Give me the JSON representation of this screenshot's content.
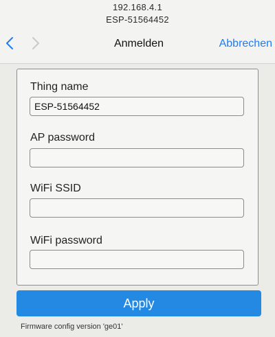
{
  "header": {
    "ip": "192.168.4.1",
    "host": "ESP-51564452",
    "title": "Anmelden",
    "cancel": "Abbrechen",
    "back_icon": "chevron-left-icon",
    "forward_icon": "chevron-right-icon"
  },
  "form": {
    "fields": [
      {
        "label": "Thing name",
        "value": "ESP-51564452",
        "placeholder": ""
      },
      {
        "label": "AP password",
        "value": "",
        "placeholder": ""
      },
      {
        "label": "WiFi SSID",
        "value": "",
        "placeholder": ""
      },
      {
        "label": "WiFi password",
        "value": "",
        "placeholder": ""
      }
    ],
    "apply_label": "Apply"
  },
  "footer": {
    "firmware": "Firmware config version 'ge01'"
  },
  "colors": {
    "accent": "#2389e3",
    "link": "#1f7cf3"
  }
}
